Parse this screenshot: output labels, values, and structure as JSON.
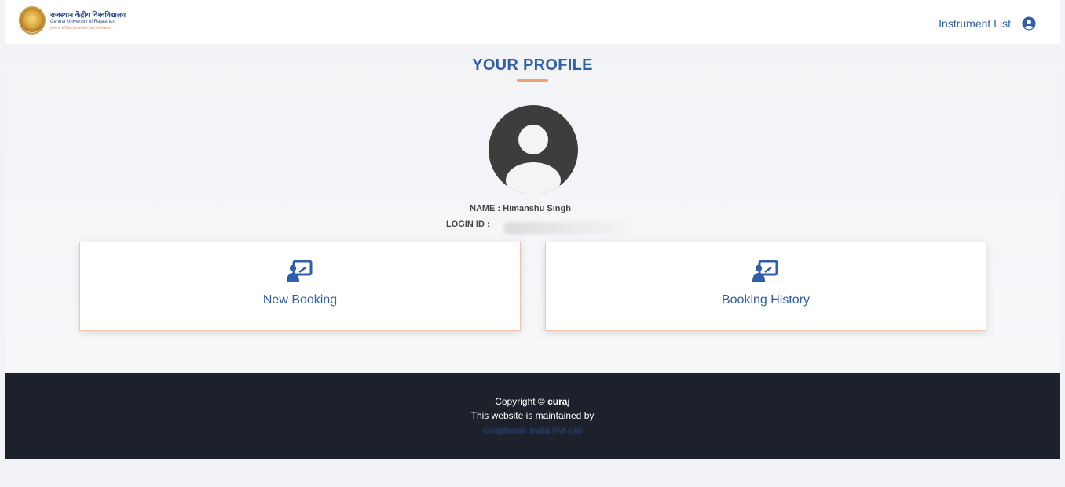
{
  "header": {
    "logo": {
      "hindi_text": "राजस्थान केंद्रीय विश्वविद्यालय",
      "english_text": "Central University of Rajasthan",
      "sub_text": "(संसद के अधिनियम द्वारा स्थापित केंद्रीय विश्वविद्यालय)"
    },
    "nav_link": "Instrument List",
    "user_icon": "user-circle-icon"
  },
  "profile": {
    "title": "YOUR PROFILE",
    "name_label": "NAME : ",
    "name_value": "Himanshu Singh",
    "login_label": "LOGIN ID :"
  },
  "cards": [
    {
      "label": "New Booking",
      "icon": "teacher-board-icon"
    },
    {
      "label": "Booking History",
      "icon": "teacher-board-icon"
    }
  ],
  "footer": {
    "copyright_prefix": "Copyright © ",
    "copyright_owner": "curaj",
    "maintained_text": "This website is maintained by",
    "maintainer": "Graphonic India Pvt Ltd"
  },
  "colors": {
    "accent": "#2f5fa8",
    "title_underline": "#f0a36e",
    "card_border": "#f2c2a8",
    "footer_bg": "#1c212b",
    "avatar": "#3d3d3d"
  }
}
